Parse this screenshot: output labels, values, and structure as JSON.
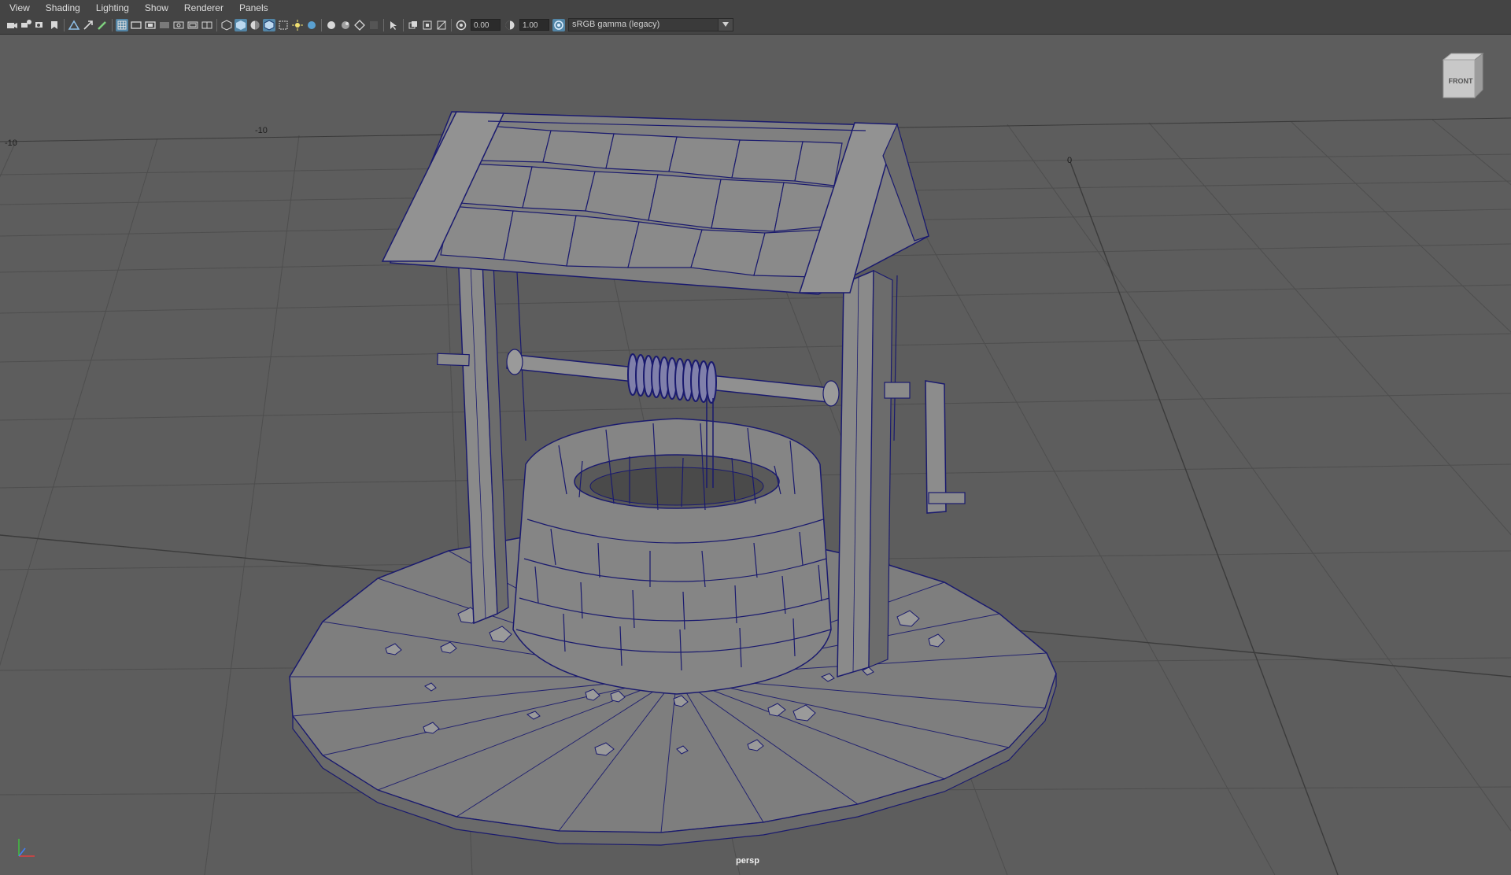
{
  "menu": {
    "items": [
      "View",
      "Shading",
      "Lighting",
      "Show",
      "Renderer",
      "Panels"
    ]
  },
  "toolbar": {
    "exposure_value": "0.00",
    "gamma_value": "1.00",
    "color_space": "sRGB gamma (legacy)",
    "icons": [
      "camera-icon",
      "camera-attributes-icon",
      "bookmark-icon",
      "image-plane-icon",
      "grid-icon",
      "film-gate-icon",
      "resolution-gate-icon",
      "gate-mask-icon",
      "field-chart-icon",
      "safe-action-icon",
      "safe-title-icon",
      "wireframe-icon",
      "smooth-shade-icon",
      "default-material-icon",
      "wireframe-on-shaded-icon",
      "xray-icon",
      "textured-icon",
      "use-all-lights-icon",
      "shadows-icon",
      "screen-space-ao-icon",
      "motion-blur-icon",
      "multisample-aa-icon",
      "depth-of-field-icon",
      "isolate-select-icon",
      "xray-joints-icon",
      "backface-culling-icon",
      "exposure-icon",
      "gamma-icon",
      "color-management-icon"
    ],
    "active_icons": [
      "grid-icon",
      "smooth-shade-icon",
      "wireframe-on-shaded-icon"
    ],
    "accent_color": "#5285a6"
  },
  "viewport": {
    "camera_name": "persp",
    "viewcube_face": "FRONT",
    "grid_labels": [
      "-10",
      "-10",
      "0"
    ],
    "background_color": "#5d5d5d",
    "wire_color": "#1a1a6e"
  }
}
